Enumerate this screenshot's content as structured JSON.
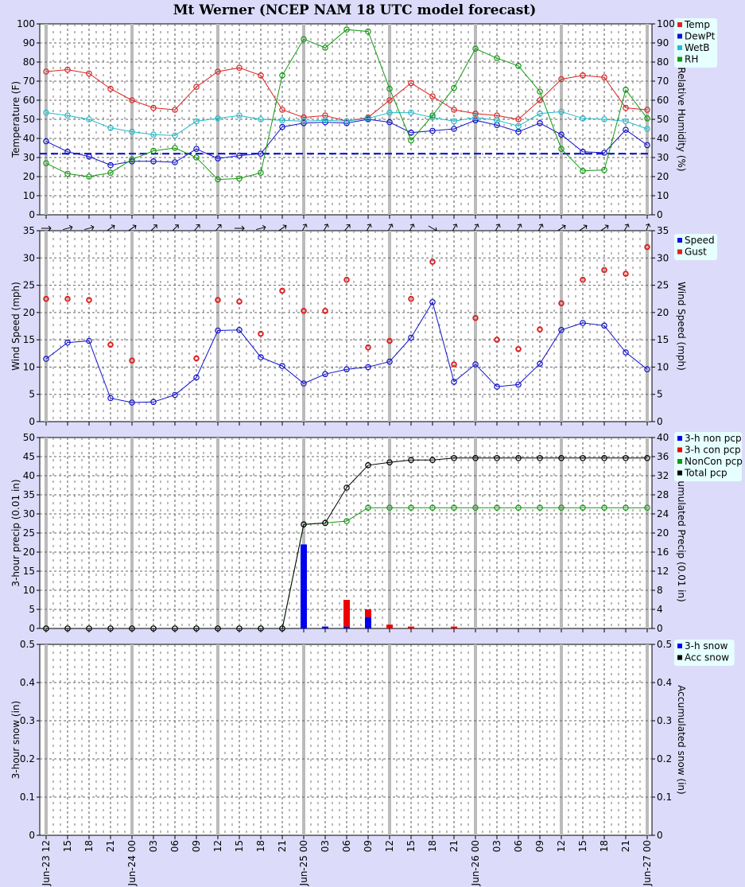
{
  "title": "Mt Werner (NCEP NAM 18 UTC model forecast)",
  "x_ticks": [
    "Jun-23 12",
    "15",
    "18",
    "21",
    "Jun-24 00",
    "03",
    "06",
    "09",
    "12",
    "15",
    "18",
    "21",
    "Jun-25 00",
    "03",
    "06",
    "09",
    "12",
    "15",
    "18",
    "21",
    "Jun-26 00",
    "03",
    "06",
    "09",
    "12",
    "15",
    "18",
    "21",
    "Jun-27 00"
  ],
  "colors": {
    "temp": "#dd2222",
    "dewpt": "#1111cc",
    "wetb": "#22bbcc",
    "rh": "#119911",
    "speed": "#1111cc",
    "gust": "#dd2222",
    "noncon": "#119911",
    "total": "#000000",
    "background": "#dcdcfa",
    "legend_bg": "#e6ffff"
  },
  "panels": {
    "temperature": {
      "ylabel": "Temperature (F)",
      "ylabel_right": "Relative Humidity (%)",
      "legend": [
        "Temp",
        "DewPt",
        "WetB",
        "RH"
      ]
    },
    "wind": {
      "ylabel": "Wind Speed (mph)",
      "ylabel_right": "Wind Speed (mph)",
      "legend": [
        "Speed",
        "Gust"
      ]
    },
    "precip": {
      "ylabel": "3-hour precip (0.01 in)",
      "ylabel_right": "Accumulated Precip (0.01 in)",
      "legend": [
        "3-h non pcp",
        "3-h con pcp",
        "NonCon pcp",
        "Total pcp"
      ]
    },
    "snow": {
      "ylabel": "3-hour snow (in)",
      "ylabel_right": "Accumulated snow (in)",
      "legend": [
        "3-h snow",
        "Acc snow"
      ]
    }
  },
  "chart_data": [
    {
      "type": "line",
      "x": [
        "Jun-23 12",
        "15",
        "18",
        "21",
        "Jun-24 00",
        "03",
        "06",
        "09",
        "12",
        "15",
        "18",
        "21",
        "Jun-25 00",
        "03",
        "06",
        "09",
        "12",
        "15",
        "18",
        "21",
        "Jun-26 00",
        "03",
        "06",
        "09",
        "12",
        "15",
        "18",
        "21",
        "Jun-27 00"
      ],
      "ylim": [
        0,
        100
      ],
      "y2lim": [
        0,
        100
      ],
      "yticks": [
        0,
        10,
        20,
        30,
        40,
        50,
        60,
        70,
        80,
        90,
        100
      ],
      "freezing_line": 32,
      "series": [
        {
          "name": "Temp",
          "values": [
            75,
            76,
            74,
            66,
            60,
            56,
            55,
            67,
            75,
            77,
            73,
            55,
            51,
            52,
            49,
            51,
            60,
            69,
            62,
            55,
            53,
            52,
            50,
            60,
            71,
            73,
            72,
            56,
            55
          ]
        },
        {
          "name": "DewPt",
          "values": [
            38.5,
            33,
            30.5,
            26,
            28,
            28,
            27.5,
            34.5,
            29.5,
            31,
            32,
            46,
            48,
            48.5,
            48,
            50,
            48.5,
            43,
            44,
            45,
            49.5,
            47,
            43.5,
            48,
            42,
            33,
            32.5,
            44.5,
            36.5
          ]
        },
        {
          "name": "WetB",
          "values": [
            53.5,
            52,
            50,
            45.5,
            43.5,
            42,
            41.5,
            49,
            50.5,
            52,
            50,
            49.5,
            49,
            49.5,
            49,
            50.5,
            53.5,
            53.5,
            51,
            49,
            51,
            49.5,
            46.5,
            53,
            54,
            50.5,
            50,
            49,
            45
          ]
        },
        {
          "name": "RH",
          "values": [
            27,
            21.5,
            20,
            22,
            29,
            33.5,
            35,
            30,
            18.5,
            19,
            22,
            73,
            92,
            87.5,
            97,
            96,
            66,
            39,
            52,
            66.5,
            87,
            82,
            78,
            64.5,
            34.5,
            23,
            23.5,
            65.5,
            50.5
          ]
        }
      ]
    },
    {
      "type": "line",
      "x": [
        "Jun-23 12",
        "15",
        "18",
        "21",
        "Jun-24 00",
        "03",
        "06",
        "09",
        "12",
        "15",
        "18",
        "21",
        "Jun-25 00",
        "03",
        "06",
        "09",
        "12",
        "15",
        "18",
        "21",
        "Jun-26 00",
        "03",
        "06",
        "09",
        "12",
        "15",
        "18",
        "21",
        "Jun-27 00"
      ],
      "ylim": [
        0,
        35
      ],
      "yticks": [
        0,
        5,
        10,
        15,
        20,
        25,
        30,
        35
      ],
      "wind_dir_deg": [
        90,
        75,
        75,
        55,
        55,
        45,
        45,
        40,
        40,
        90,
        75,
        55,
        30,
        30,
        40,
        30,
        30,
        30,
        120,
        30,
        30,
        30,
        30,
        30,
        55,
        55,
        55,
        30,
        20
      ],
      "series": [
        {
          "name": "Speed",
          "values": [
            11.5,
            14.5,
            14.8,
            4.3,
            3.5,
            3.6,
            4.9,
            8.1,
            16.7,
            16.8,
            11.8,
            10.2,
            7,
            8.7,
            9.6,
            10,
            11,
            15.4,
            21.9,
            7.3,
            10.5,
            6.4,
            6.8,
            10.6,
            16.8,
            18.1,
            17.6,
            12.7,
            9.6
          ]
        },
        {
          "name": "Gust",
          "values": [
            22.5,
            22.5,
            22.3,
            14.1,
            11.2,
            null,
            null,
            11.6,
            22.3,
            22,
            16.1,
            24,
            20.3,
            20.3,
            26,
            13.6,
            14.8,
            22.5,
            29.3,
            10.5,
            19,
            15,
            13.3,
            16.9,
            21.7,
            26,
            27.8,
            27.1,
            32
          ]
        }
      ]
    },
    {
      "type": "bar",
      "x": [
        "Jun-23 12",
        "15",
        "18",
        "21",
        "Jun-24 00",
        "03",
        "06",
        "09",
        "12",
        "15",
        "18",
        "21",
        "Jun-25 00",
        "03",
        "06",
        "09",
        "12",
        "15",
        "18",
        "21",
        "Jun-26 00",
        "03",
        "06",
        "09",
        "12",
        "15",
        "18",
        "21",
        "Jun-27 00"
      ],
      "ylim": [
        0,
        50
      ],
      "y2lim": [
        0,
        40
      ],
      "yticks": [
        0,
        5,
        10,
        15,
        20,
        25,
        30,
        35,
        40,
        45,
        50
      ],
      "y2ticks": [
        0,
        4,
        8,
        12,
        16,
        20,
        24,
        28,
        32,
        36,
        40
      ],
      "series": [
        {
          "name": "3-h non pcp",
          "values": [
            0,
            0,
            0,
            0,
            0,
            0,
            0,
            0,
            0,
            0,
            0,
            0,
            22,
            0.5,
            0.5,
            3,
            0,
            0,
            0,
            0,
            0,
            0,
            0,
            0,
            0,
            0,
            0,
            0,
            0
          ]
        },
        {
          "name": "3-h con pcp",
          "values": [
            0,
            0,
            0,
            0,
            0,
            0,
            0,
            0,
            0,
            0,
            0,
            0,
            0,
            0,
            7,
            2,
            1,
            0.5,
            0,
            0.5,
            0,
            0,
            0,
            0,
            0,
            0,
            0,
            0,
            0
          ]
        },
        {
          "name": "NonCon pcp",
          "values": [
            0,
            0,
            0,
            0,
            0,
            0,
            0,
            0,
            0,
            0,
            0,
            0,
            21.8,
            22.1,
            22.5,
            25.3,
            25.3,
            25.3,
            25.3,
            25.3,
            25.3,
            25.3,
            25.3,
            25.3,
            25.3,
            25.3,
            25.3,
            25.3,
            25.3
          ]
        },
        {
          "name": "Total pcp",
          "values": [
            0,
            0,
            0,
            0,
            0,
            0,
            0,
            0,
            0,
            0,
            0,
            0,
            21.8,
            22.1,
            29.5,
            34.2,
            34.8,
            35.3,
            35.3,
            35.7,
            35.7,
            35.7,
            35.7,
            35.7,
            35.7,
            35.7,
            35.7,
            35.7,
            35.7
          ]
        }
      ]
    },
    {
      "type": "bar",
      "x": [
        "Jun-23 12",
        "15",
        "18",
        "21",
        "Jun-24 00",
        "03",
        "06",
        "09",
        "12",
        "15",
        "18",
        "21",
        "Jun-25 00",
        "03",
        "06",
        "09",
        "12",
        "15",
        "18",
        "21",
        "Jun-26 00",
        "03",
        "06",
        "09",
        "12",
        "15",
        "18",
        "21",
        "Jun-27 00"
      ],
      "ylim": [
        0,
        0.5
      ],
      "y2lim": [
        0,
        0.5
      ],
      "yticks": [
        0,
        0.1,
        0.2,
        0.3,
        0.4,
        0.5
      ],
      "series": [
        {
          "name": "3-h snow",
          "values": [
            0,
            0,
            0,
            0,
            0,
            0,
            0,
            0,
            0,
            0,
            0,
            0,
            0,
            0,
            0,
            0,
            0,
            0,
            0,
            0,
            0,
            0,
            0,
            0,
            0,
            0,
            0,
            0,
            0
          ]
        },
        {
          "name": "Acc snow",
          "values": [
            0,
            0,
            0,
            0,
            0,
            0,
            0,
            0,
            0,
            0,
            0,
            0,
            0,
            0,
            0,
            0,
            0,
            0,
            0,
            0,
            0,
            0,
            0,
            0,
            0,
            0,
            0,
            0,
            0
          ]
        }
      ]
    }
  ]
}
